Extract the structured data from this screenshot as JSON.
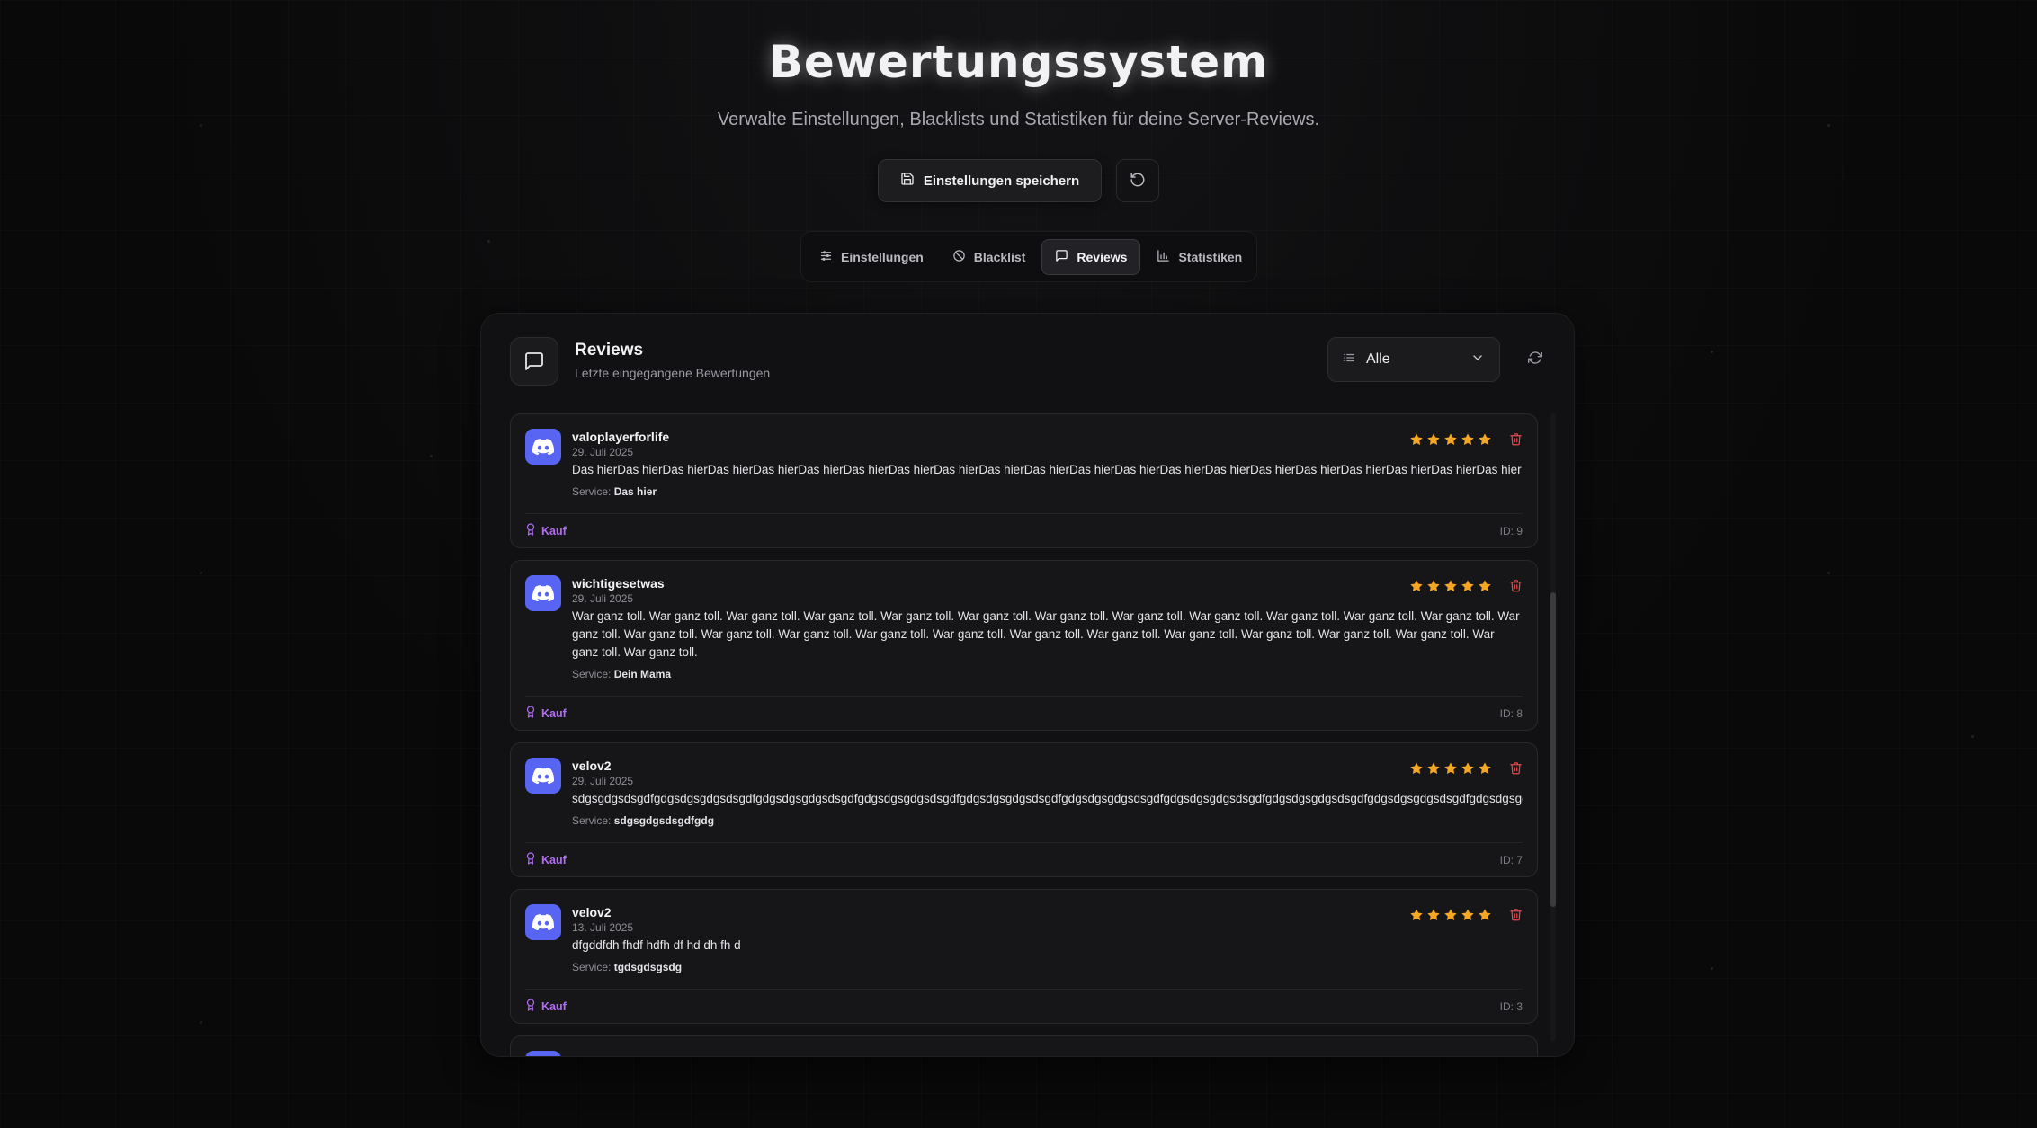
{
  "header": {
    "title": "Bewertungssystem",
    "subtitle": "Verwalte Einstellungen, Blacklists und Statistiken für deine Server-Reviews."
  },
  "actions": {
    "save_label": "Einstellungen speichern"
  },
  "tabs": [
    {
      "label": "Einstellungen",
      "icon": "sliders-icon",
      "active": false
    },
    {
      "label": "Blacklist",
      "icon": "ban-icon",
      "active": false
    },
    {
      "label": "Reviews",
      "icon": "message-icon",
      "active": true
    },
    {
      "label": "Statistiken",
      "icon": "bar-chart-icon",
      "active": false
    }
  ],
  "panel": {
    "title": "Reviews",
    "subtitle": "Letzte eingegangene Bewertungen",
    "filter_value": "Alle"
  },
  "colors": {
    "accent_discord": "#5865f2",
    "star": "#f5a623",
    "tag": "#b26cf6",
    "delete": "#e5484d"
  },
  "service_label": "Service:",
  "reviews": [
    {
      "user": "valoplayerforlife",
      "date": "29. Juli 2025",
      "text": "Das hierDas hierDas hierDas hierDas hierDas hierDas hierDas hierDas hierDas hierDas hierDas hierDas hierDas hierDas hierDas hierDas hierDas hierDas hierDas hierDas hier",
      "service": "Das hier",
      "rating": 5,
      "tag": "Kauf",
      "id": "ID: 9"
    },
    {
      "user": "wichtigesetwas",
      "date": "29. Juli 2025",
      "text": "War ganz toll. War ganz toll. War ganz toll. War ganz toll. War ganz toll. War ganz toll. War ganz toll. War ganz toll. War ganz toll. War ganz toll. War ganz toll. War ganz toll. War ganz toll. War ganz toll. War ganz toll. War ganz toll. War ganz toll. War ganz toll. War ganz toll. War ganz toll. War ganz toll. War ganz toll. War ganz toll. War ganz toll. War ganz toll. War ganz toll.",
      "service": "Dein Mama",
      "rating": 5,
      "tag": "Kauf",
      "id": "ID: 8"
    },
    {
      "user": "velov2",
      "date": "29. Juli 2025",
      "text": "sdgsgdgsdsgdfgdgsdgsgdgsdsgdfgdgsdgsgdgsdsgdfgdgsdgsgdgsdsgdfgdgsdgsgdgsdsgdfgdgsdgsgdgsdsgdfgdgsdgsgdgsdsgdfgdgsdgsgdgsdsgdfgdgsdgsgdgsdsgdfgdgsdgsgdgsdsgdfgdg",
      "service": "sdgsgdgsdsgdfgdg",
      "rating": 5,
      "tag": "Kauf",
      "id": "ID: 7"
    },
    {
      "user": "velov2",
      "date": "13. Juli 2025",
      "text": "dfgddfdh fhdf hdfh df hd dh fh d",
      "service": "tgdsgdsgsdg",
      "rating": 5,
      "tag": "Kauf",
      "id": "ID: 3"
    }
  ]
}
